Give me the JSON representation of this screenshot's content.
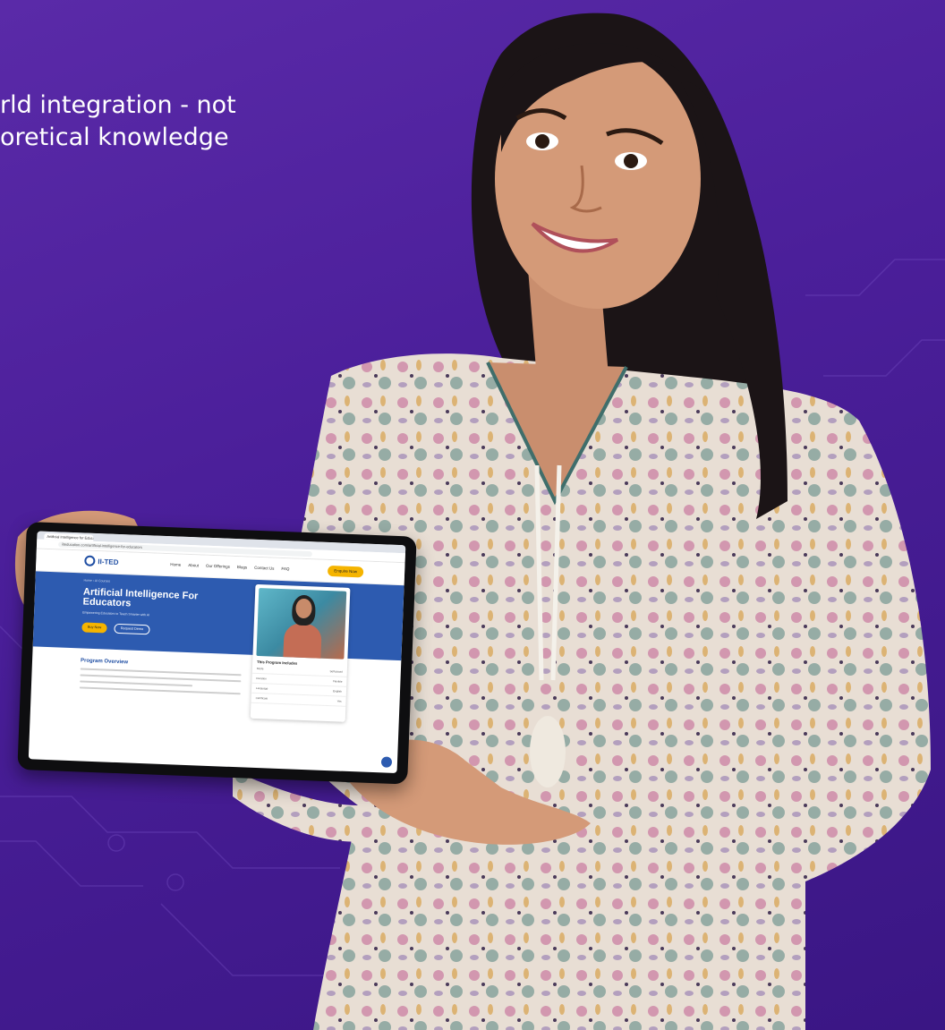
{
  "headline": {
    "line1": "rld integration - not",
    "line2": "oretical knowledge"
  },
  "tablet": {
    "browser_tab": "Artificial Intelligence for Educators",
    "url": "iiteducation.com/artificial-intelligence-for-educators",
    "logo_text": "II-TED",
    "nav": [
      "Home",
      "About",
      "Our Offerings",
      "Blogs",
      "Contact Us",
      "FAQ"
    ],
    "enquire_label": "Enquire Now",
    "breadcrumb": "Home › AI Courses",
    "hero_title": "Artificial Intelligence For Educators",
    "hero_subtitle": "Empowering Educators to Teach Smarter with AI",
    "buy_label": "Buy Now",
    "request_label": "Request Demo",
    "card_heading": "This Program Includes",
    "card_rows": [
      {
        "label": "Mode",
        "value": "Self-paced"
      },
      {
        "label": "Duration",
        "value": "Flexible"
      },
      {
        "label": "Language",
        "value": "English"
      },
      {
        "label": "Certificate",
        "value": "Yes"
      }
    ],
    "overview_title": "Program Overview"
  },
  "colors": {
    "background": "#4b1f9a",
    "site_blue": "#2d5bb0",
    "accent_yellow": "#f5b400"
  }
}
